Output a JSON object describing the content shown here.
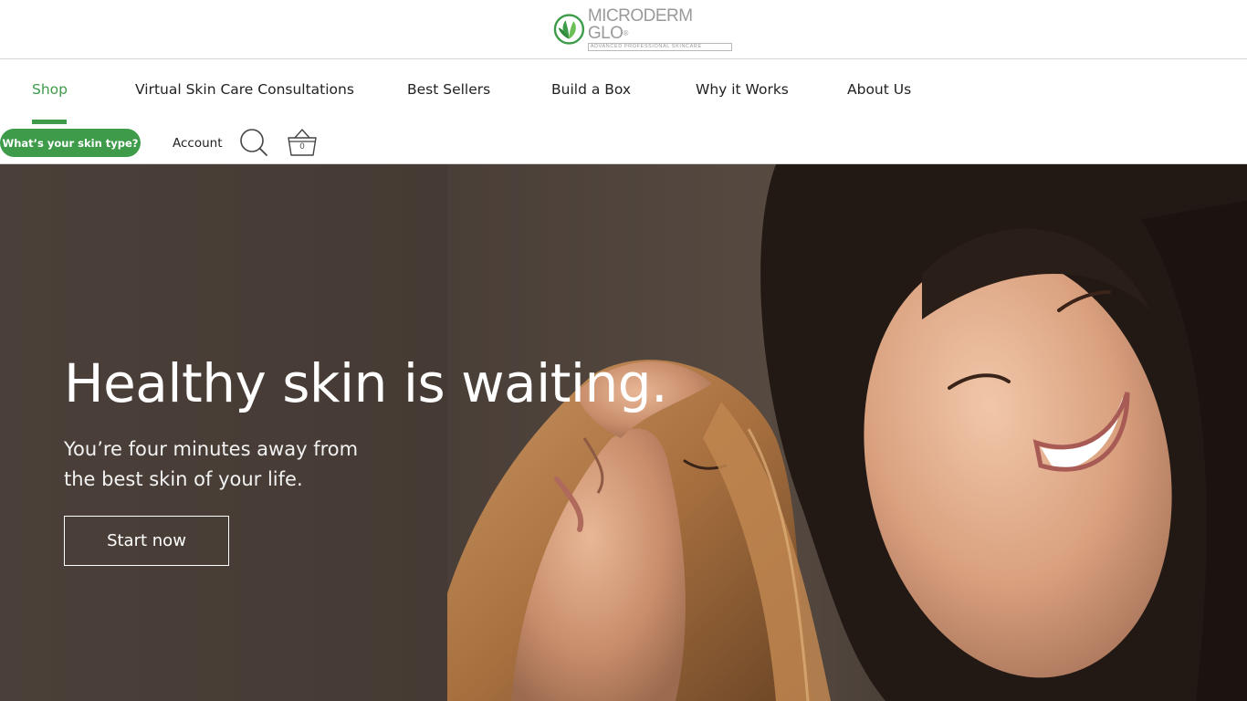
{
  "brand": {
    "name": "MICRODERM GLO",
    "registered": "®",
    "tagline": "ADVANCED PROFESSIONAL SKINCARE",
    "accent_color": "#3d9b4a"
  },
  "nav": {
    "items": [
      {
        "label": "Shop",
        "active": true
      },
      {
        "label": "Virtual Skin Care Consultations",
        "active": false
      },
      {
        "label": "Best Sellers",
        "active": false
      },
      {
        "label": "Build a Box",
        "active": false
      },
      {
        "label": "Why it Works",
        "active": false
      },
      {
        "label": "About Us",
        "active": false
      }
    ]
  },
  "utility": {
    "skin_type_label": "What’s your skin type?",
    "account_label": "Account",
    "search_icon": "search-icon",
    "cart_icon": "basket-icon",
    "cart_count": "0"
  },
  "hero": {
    "title": "Healthy skin is waiting.",
    "subtitle": "You’re four minutes away from the best skin of your life.",
    "cta_label": "Start now"
  }
}
